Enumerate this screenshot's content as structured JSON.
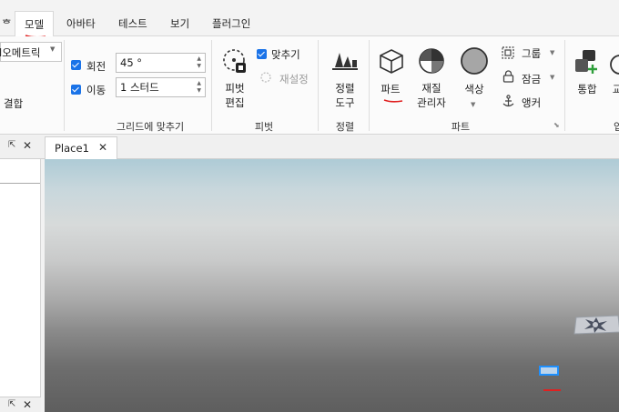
{
  "menu_tabs": [
    {
      "label": "ᄒ",
      "active": false
    },
    {
      "label": "모델",
      "active": true
    },
    {
      "label": "아바타",
      "active": false
    },
    {
      "label": "테스트",
      "active": false
    },
    {
      "label": "보기",
      "active": false
    },
    {
      "label": "플러그인",
      "active": false
    }
  ],
  "ribbon": {
    "left_group": {
      "dropdown_value": "l오메트릭",
      "join_label": "결합"
    },
    "grid": {
      "rotate_label": "회전",
      "rotate_value": "45 °",
      "move_label": "이동",
      "move_value": "1 스터드",
      "group_label": "그리드에 맞추기"
    },
    "pivot": {
      "edit_label_1": "피벗",
      "edit_label_2": "편집",
      "snap_label": "맞추기",
      "reset_label": "재설정",
      "group_label": "피벗"
    },
    "align": {
      "tool_label_1": "정렬",
      "tool_label_2": "도구",
      "group_label": "정렬"
    },
    "part": {
      "part_label": "파트",
      "material_label_1": "재질",
      "material_label_2": "관리자",
      "color_label": "색상",
      "group_btn_label": "그룹",
      "lock_label": "잠금",
      "anchor_label": "앵커",
      "group_label": "파트"
    },
    "right": {
      "union_label": "통합",
      "partial_label": "교",
      "group_partial": "입"
    }
  },
  "doc_tab": {
    "title": "Place1"
  },
  "colors": {
    "accent": "#1a73e8",
    "annotation": "#e02020",
    "selection": "#1e90ff"
  }
}
